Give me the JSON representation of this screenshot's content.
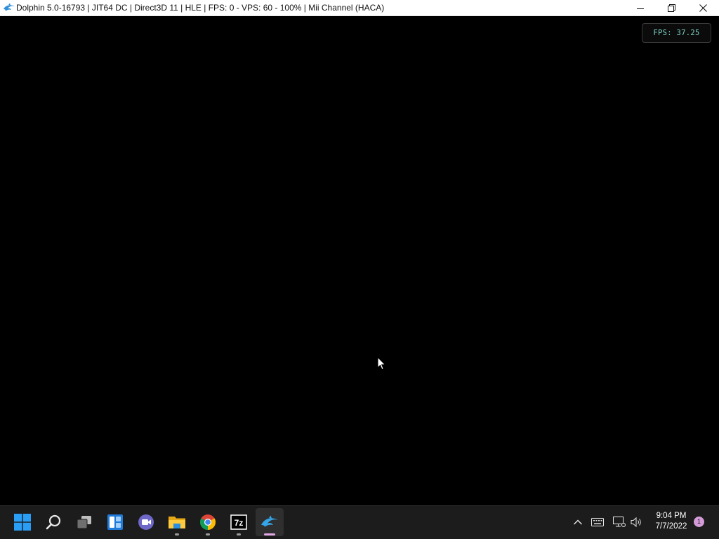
{
  "window": {
    "title": "Dolphin 5.0-16793 | JIT64 DC | Direct3D 11 | HLE | FPS: 0 - VPS: 60 - 100% | Mii Channel (HACA)",
    "app_icon": "dolphin-icon",
    "controls": [
      "minimize-icon",
      "restore-icon",
      "close-icon"
    ]
  },
  "game": {
    "fps_overlay": "FPS: 37.25"
  },
  "taskbar": {
    "apps": [
      {
        "name": "start",
        "icon": "windows-start-icon",
        "running": false
      },
      {
        "name": "search",
        "icon": "search-icon",
        "running": false
      },
      {
        "name": "task-view",
        "icon": "task-view-icon",
        "running": false
      },
      {
        "name": "widgets",
        "icon": "widgets-icon",
        "running": false
      },
      {
        "name": "teams-chat",
        "icon": "teams-chat-icon",
        "running": false
      },
      {
        "name": "file-explorer",
        "icon": "folder-icon",
        "running": true
      },
      {
        "name": "chrome",
        "icon": "chrome-icon",
        "running": true
      },
      {
        "name": "7-zip",
        "icon": "7zip-icon",
        "running": true
      },
      {
        "name": "dolphin",
        "icon": "dolphin-icon",
        "running": true,
        "active": true
      }
    ],
    "tray": {
      "icons": [
        "chevron-up-icon",
        "keyboard-icon",
        "network-icon",
        "volume-icon"
      ],
      "time": "9:04 PM",
      "date": "7/7/2022",
      "notification_count": "1"
    },
    "accent_color": "#e2a8e6"
  }
}
